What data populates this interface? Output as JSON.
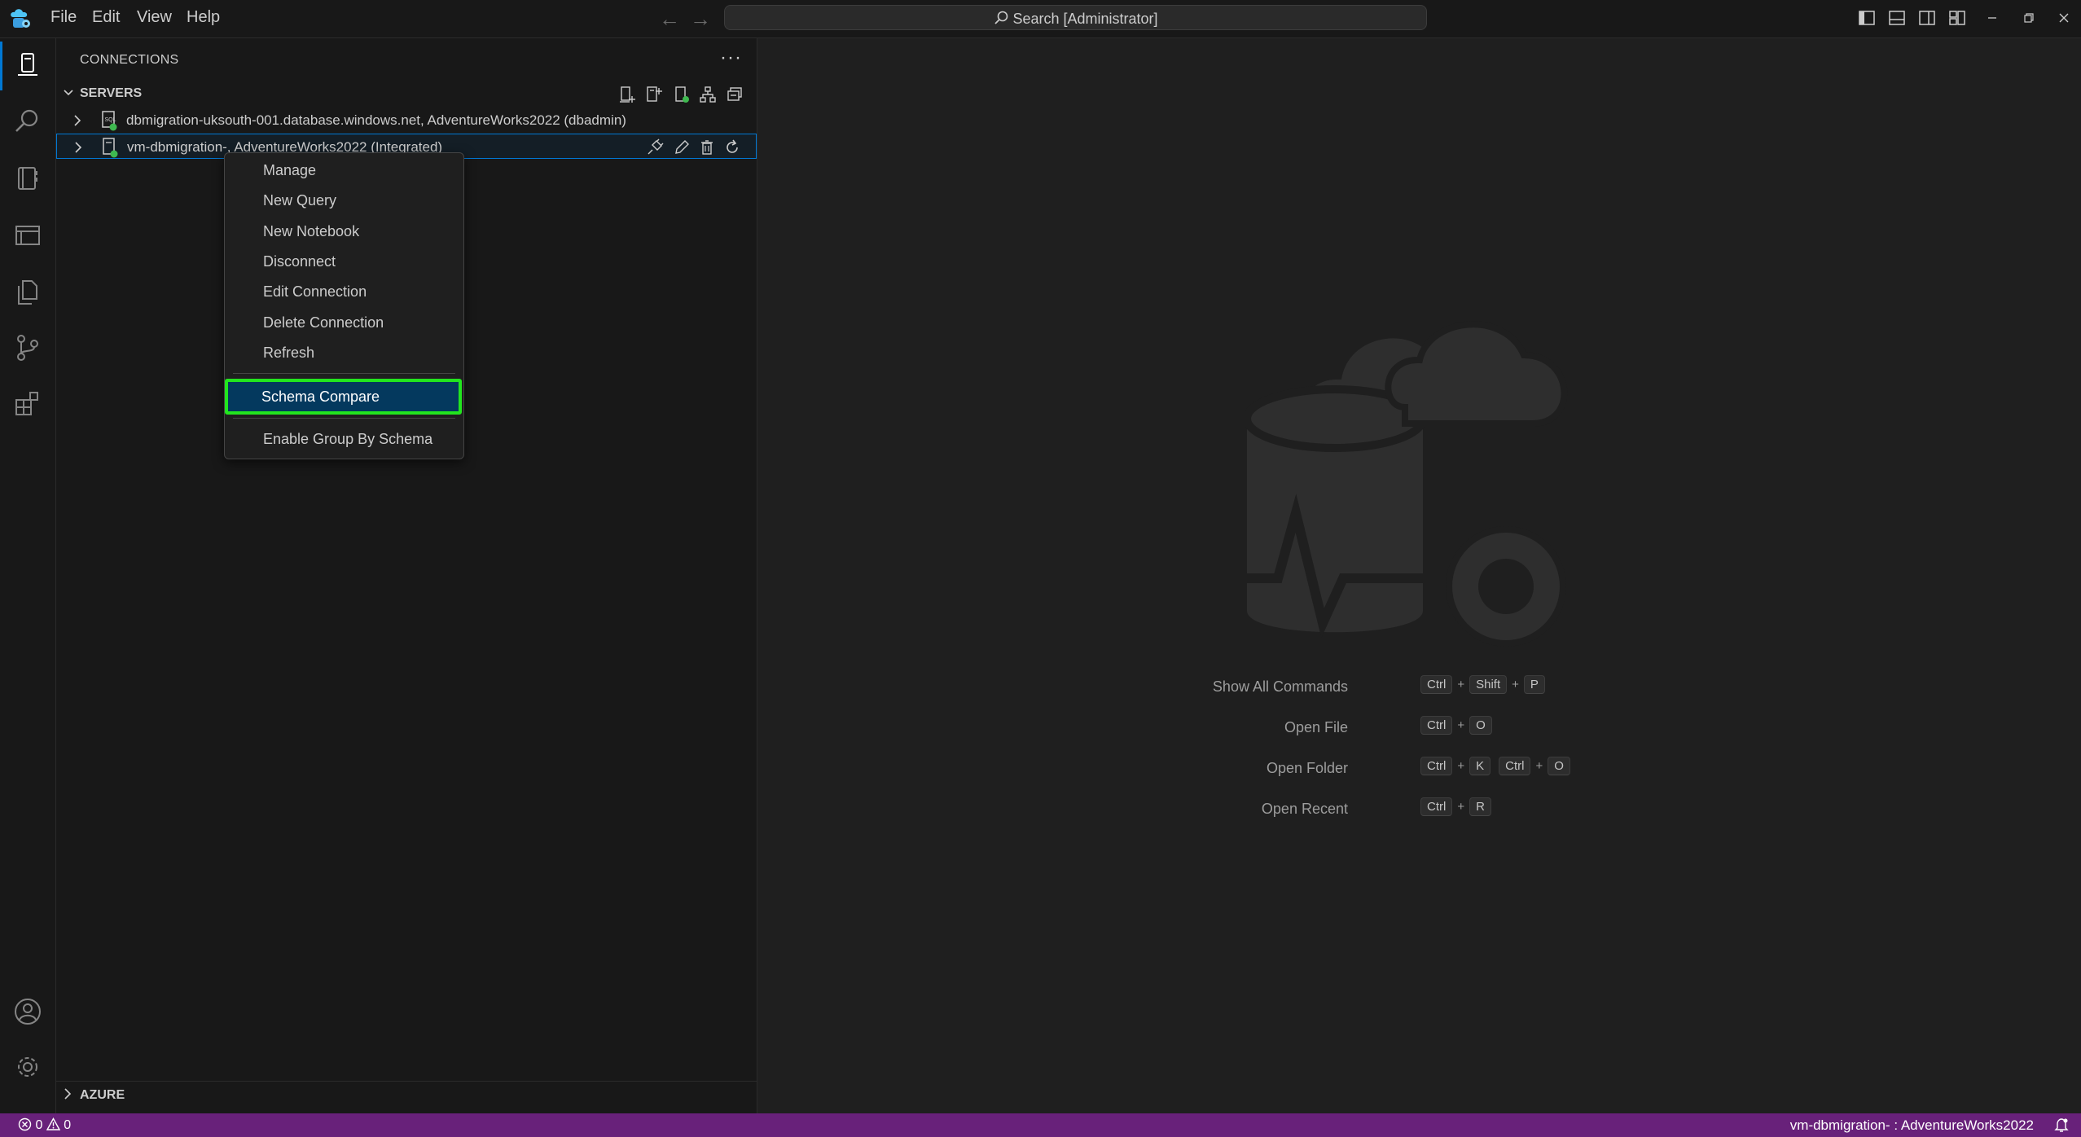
{
  "titlebar": {
    "menus": [
      "File",
      "Edit",
      "View",
      "Help"
    ],
    "search_placeholder": "Search [Administrator]"
  },
  "activity_bar": {
    "icons": [
      "connections-icon",
      "search-icon",
      "notebooks-icon",
      "bookmarks-icon",
      "explorer-icon",
      "source-control-icon",
      "extensions-icon",
      "account-icon",
      "settings-icon"
    ]
  },
  "sidebar": {
    "title": "CONNECTIONS",
    "servers_header": "SERVERS",
    "servers": [
      {
        "label": "dbmigration-uksouth-001.database.windows.net, AdventureWorks2022 (dbadmin)",
        "status": "connected"
      },
      {
        "label": "vm-dbmigration-, AdventureWorks2022 (Integrated)",
        "status": "connected",
        "selected": true
      }
    ],
    "azure_header": "AZURE"
  },
  "context_menu": {
    "items": [
      "Manage",
      "New Query",
      "New Notebook",
      "Disconnect",
      "Edit Connection",
      "Delete Connection",
      "Refresh"
    ],
    "highlighted_item": "Schema Compare",
    "footer_item": "Enable Group By Schema"
  },
  "welcome": {
    "shortcuts": [
      {
        "label": "Show All Commands",
        "keys": [
          "Ctrl",
          "Shift",
          "P"
        ]
      },
      {
        "label": "Open File",
        "keys": [
          "Ctrl",
          "O"
        ]
      },
      {
        "label": "Open Folder",
        "keys": [
          "Ctrl",
          "K"
        ],
        "chord": [
          "Ctrl",
          "O"
        ]
      },
      {
        "label": "Open Recent",
        "keys": [
          "Ctrl",
          "R"
        ]
      }
    ]
  },
  "statusbar": {
    "errors": "0",
    "warnings": "0",
    "connection": "vm-dbmigration- : AdventureWorks2022"
  },
  "colors": {
    "accent": "#0078d4",
    "statusbar": "#68217a",
    "menu_highlight": "#04395e",
    "annotation_box": "#22e51e",
    "connected_dot": "#3fb950"
  }
}
